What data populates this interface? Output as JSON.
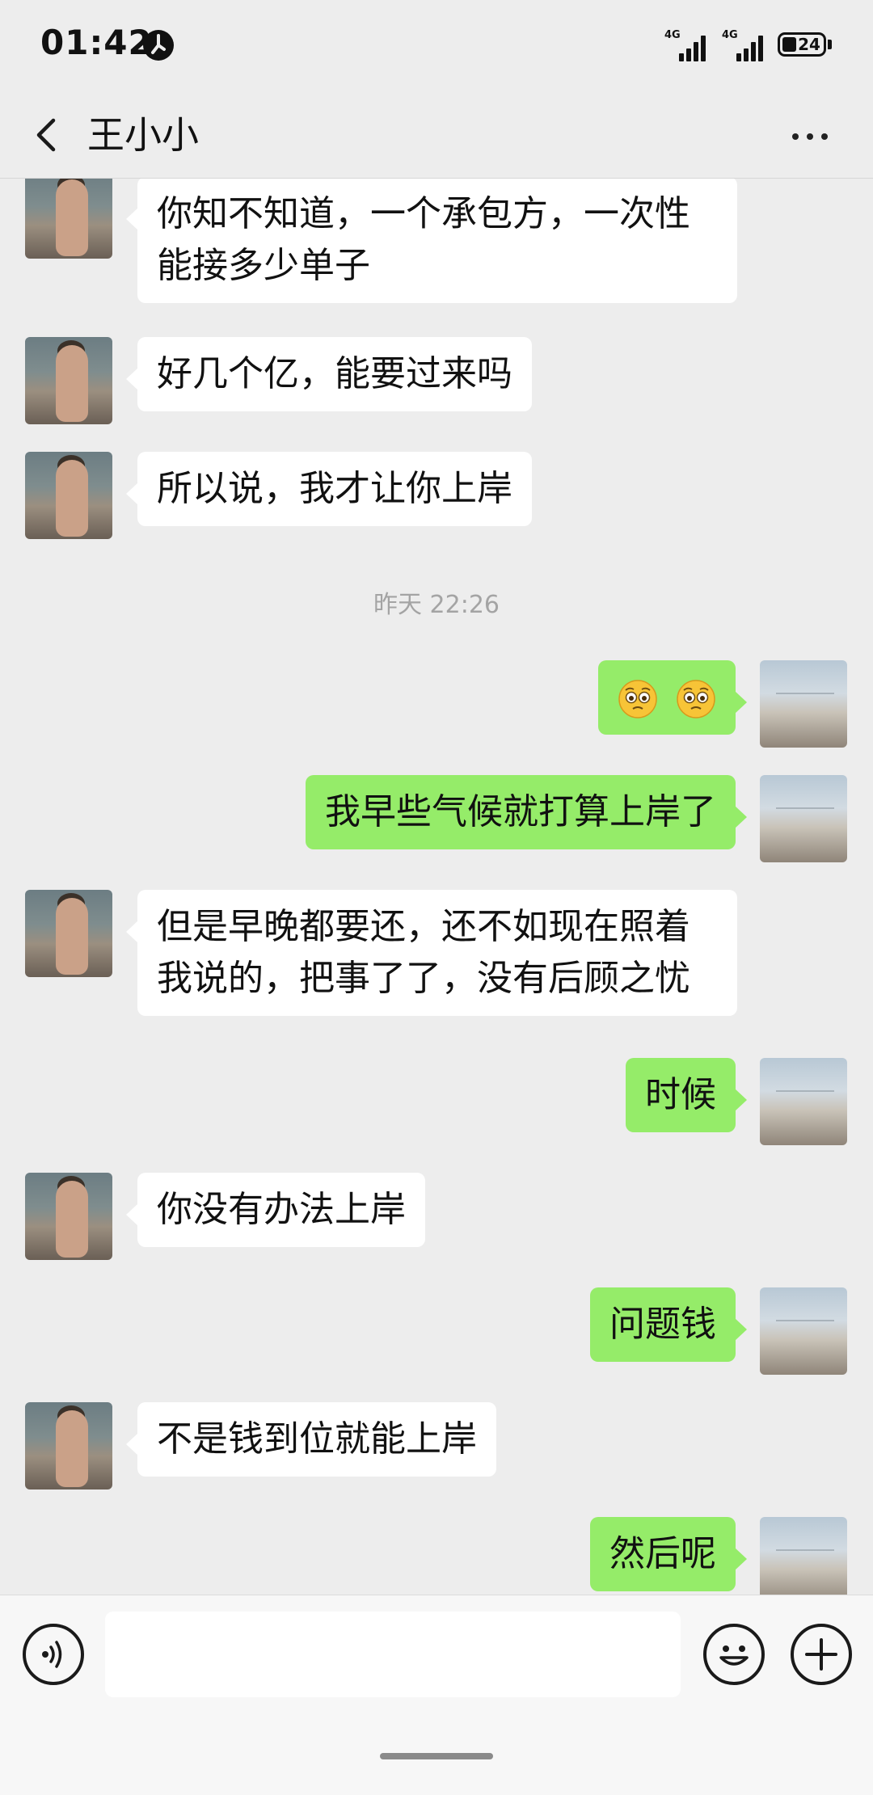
{
  "status_bar": {
    "time": "01:42",
    "network_1": "4G",
    "network_2": "4G",
    "battery": "24"
  },
  "header": {
    "title": "王小小",
    "back_icon": "chevron-left-icon",
    "more_icon": "more-dots-icon"
  },
  "messages": [
    {
      "side": "left",
      "text": "你知不知道，一个承包方，一次性能接多少单子"
    },
    {
      "side": "left",
      "text": "好几个亿，能要过来吗"
    },
    {
      "side": "left",
      "text": "所以说，我才让你上岸"
    },
    {
      "type": "timestamp",
      "text": "昨天 22:26"
    },
    {
      "side": "right",
      "emoji": [
        "pleading-face-emoji",
        "pleading-face-emoji"
      ]
    },
    {
      "side": "right",
      "text": "我早些气候就打算上岸了"
    },
    {
      "side": "left",
      "text": "但是早晚都要还，还不如现在照着我说的，把事了了，没有后顾之忧"
    },
    {
      "side": "right",
      "text": "时候"
    },
    {
      "side": "left",
      "text": "你没有办法上岸"
    },
    {
      "side": "right",
      "text": "问题钱"
    },
    {
      "side": "left",
      "text": "不是钱到位就能上岸"
    },
    {
      "side": "right",
      "text": "然后呢"
    }
  ],
  "input_bar": {
    "voice_icon": "voice-icon",
    "text_value": "",
    "emoji_icon": "smiley-icon",
    "plus_icon": "plus-icon"
  },
  "colors": {
    "background": "#ededed",
    "bubble_sent": "#95ec69",
    "bubble_received": "#ffffff"
  }
}
